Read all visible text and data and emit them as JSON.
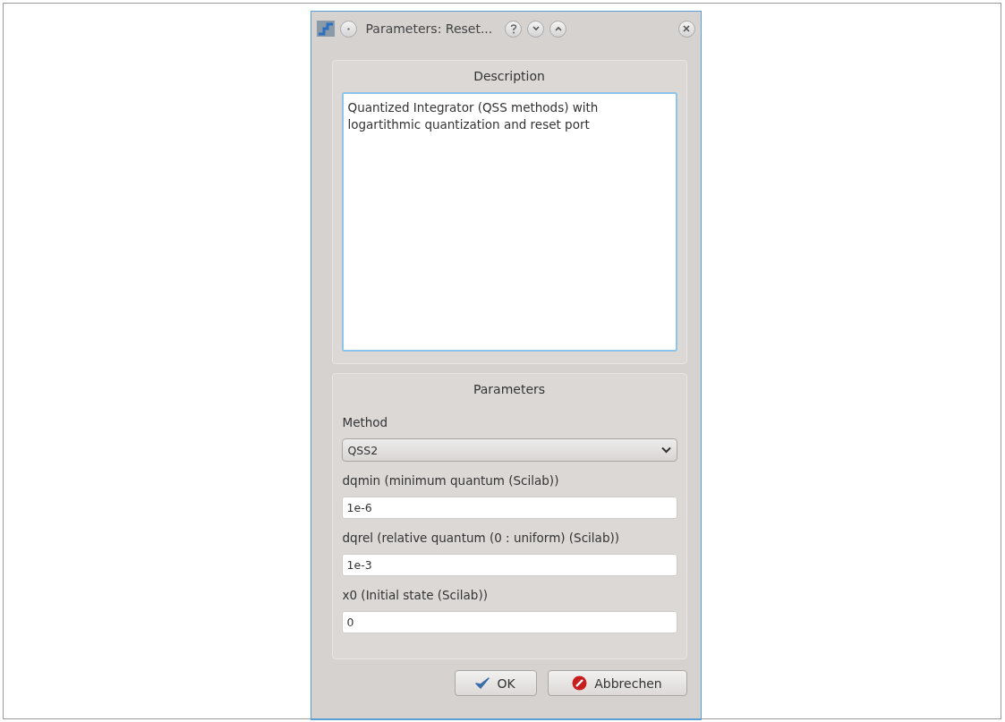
{
  "window": {
    "title": "Parameters: Reset..."
  },
  "description": {
    "heading": "Description",
    "text": "Quantized Integrator (QSS methods) with logartithmic quantization and reset port"
  },
  "parameters": {
    "heading": "Parameters",
    "fields": [
      {
        "kind": "dropdown",
        "label": "Method",
        "value": "QSS2"
      },
      {
        "kind": "text",
        "label": "dqmin (minimum quantum (Scilab))",
        "value": "1e-6"
      },
      {
        "kind": "text",
        "label": "dqrel (relative quantum (0 : uniform) (Scilab))",
        "value": "1e-3"
      },
      {
        "kind": "text",
        "label": "x0 (Initial state (Scilab))",
        "value": "0"
      }
    ]
  },
  "buttons": [
    {
      "kind": "ok",
      "label": "OK"
    },
    {
      "kind": "cancel",
      "label": "Abbrechen"
    }
  ]
}
